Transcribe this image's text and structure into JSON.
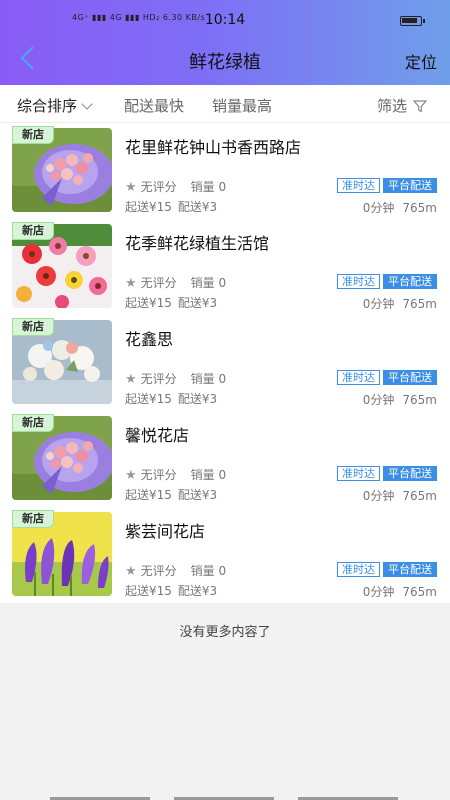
{
  "status": {
    "network": "4G⁺ ▮▮▮  4G ▮▮▮  HD₂  6.30 KB/s",
    "time": "10:14"
  },
  "header": {
    "title": "鲜花绿植",
    "locate_label": "定位"
  },
  "filters": {
    "sort_label": "综合排序",
    "fast_label": "配送最快",
    "sales_label": "销量最高",
    "filter_label": "筛选"
  },
  "shops": [
    {
      "badge": "新店",
      "name": "花里鲜花钟山书香西路店",
      "rating": "无评分",
      "sales": "销量 0",
      "min_order": "起送¥15",
      "delivery_fee": "配送¥3",
      "tag_on_time": "准时达",
      "tag_platform": "平台配送",
      "time": "0分钟",
      "distance": "765m",
      "image": "bouquet-pink-purple"
    },
    {
      "badge": "新店",
      "name": "花季鲜花绿植生活馆",
      "rating": "无评分",
      "sales": "销量 0",
      "min_order": "起送¥15",
      "delivery_fee": "配送¥3",
      "tag_on_time": "准时达",
      "tag_platform": "平台配送",
      "time": "0分钟",
      "distance": "765m",
      "image": "gerbera-flowers"
    },
    {
      "badge": "新店",
      "name": "花鑫思",
      "rating": "无评分",
      "sales": "销量 0",
      "min_order": "起送¥15",
      "delivery_fee": "配送¥3",
      "tag_on_time": "准时达",
      "tag_platform": "平台配送",
      "time": "0分钟",
      "distance": "765m",
      "image": "white-flower-arrangement"
    },
    {
      "badge": "新店",
      "name": "馨悦花店",
      "rating": "无评分",
      "sales": "销量 0",
      "min_order": "起送¥15",
      "delivery_fee": "配送¥3",
      "tag_on_time": "准时达",
      "tag_platform": "平台配送",
      "time": "0分钟",
      "distance": "765m",
      "image": "bouquet-pink-purple"
    },
    {
      "badge": "新店",
      "name": "紫芸间花店",
      "rating": "无评分",
      "sales": "销量 0",
      "min_order": "起送¥15",
      "delivery_fee": "配送¥3",
      "tag_on_time": "准时达",
      "tag_platform": "平台配送",
      "time": "0分钟",
      "distance": "765m",
      "image": "purple-crocus"
    }
  ],
  "footer": {
    "no_more": "没有更多内容了"
  },
  "colors": {
    "header_start": "#8a5cf6",
    "header_end": "#6f9fea",
    "tag_blue": "#3a8ee6",
    "badge_green": "#d8f4d6"
  }
}
